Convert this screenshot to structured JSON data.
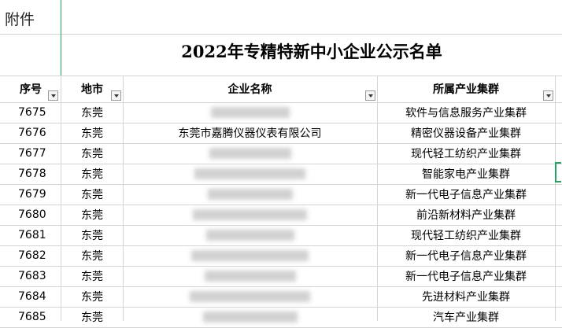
{
  "sheet": {
    "attachment_label": "附件",
    "title": "2022年专精特新中小企业公示名单"
  },
  "headers": {
    "id": "序号",
    "city": "地市",
    "company": "企业名称",
    "cluster": "所属产业集群"
  },
  "rows": [
    {
      "id": "7675",
      "city": "东莞",
      "company": "",
      "cluster": "软件与信息服务产业集群"
    },
    {
      "id": "7676",
      "city": "东莞",
      "company": "东莞市嘉腾仪器仪表有限公司",
      "cluster": "精密仪器设备产业集群"
    },
    {
      "id": "7677",
      "city": "东莞",
      "company": "",
      "cluster": "现代轻工纺织产业集群"
    },
    {
      "id": "7678",
      "city": "东莞",
      "company": "",
      "cluster": "智能家电产业集群"
    },
    {
      "id": "7679",
      "city": "东莞",
      "company": "",
      "cluster": "新一代电子信息产业集群"
    },
    {
      "id": "7680",
      "city": "东莞",
      "company": "",
      "cluster": "前沿新材料产业集群"
    },
    {
      "id": "7681",
      "city": "东莞",
      "company": "",
      "cluster": "现代轻工纺织产业集群"
    },
    {
      "id": "7682",
      "city": "东莞",
      "company": "",
      "cluster": "新一代电子信息产业集群"
    },
    {
      "id": "7683",
      "city": "东莞",
      "company": "",
      "cluster": "新一代电子信息产业集群"
    },
    {
      "id": "7684",
      "city": "东莞",
      "company": "",
      "cluster": "先进材料产业集群"
    },
    {
      "id": "7685",
      "city": "东莞",
      "company": "",
      "cluster": "汽车产业集群"
    }
  ]
}
